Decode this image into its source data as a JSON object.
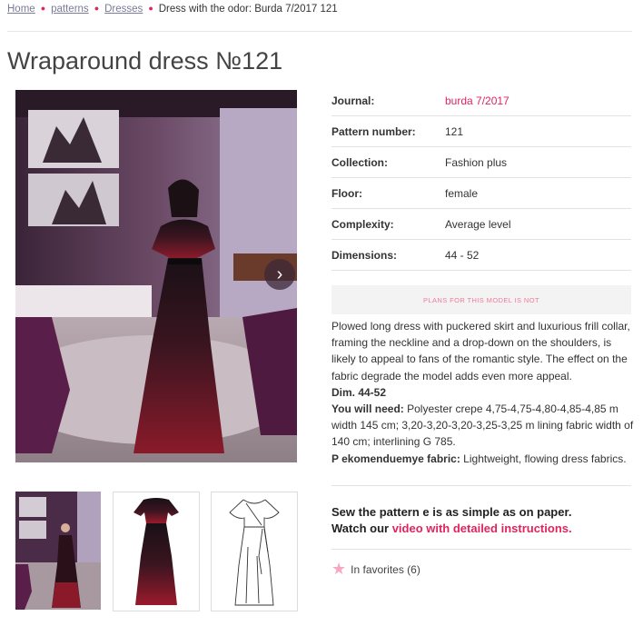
{
  "breadcrumb": {
    "items": [
      "Home",
      "patterns",
      "Dresses"
    ],
    "current": "Dress with the odor: Burda 7/2017 121"
  },
  "title": "Wraparound dress №121",
  "specs": [
    {
      "key": "Journal:",
      "value": "burda 7/2017"
    },
    {
      "key": "Pattern number:",
      "value": "121"
    },
    {
      "key": "Collection:",
      "value": "Fashion plus"
    },
    {
      "key": "Floor:",
      "value": "female"
    },
    {
      "key": "Complexity:",
      "value": "Average level"
    },
    {
      "key": "Dimensions:",
      "value": "44 - 52"
    }
  ],
  "plans_notice": "PLANS FOR THIS MODEL IS NOT",
  "description": {
    "text": "Plowed long dress with puckered skirt and luxurious frill collar, framing the neckline and a drop-down on the shoulders, is likely to appeal to fans of the romantic style. The effect on the fabric degrade the model adds even more appeal.",
    "dim": "Dim. 44-52",
    "need_label": "You will need:",
    "need_text": " Polyester crepe 4,75-4,75-4,80-4,85-4,85 m width 145 cm; 3,20-3,20-3,20-3,25-3,25 m lining fabric width of 140 cm; interlining G 785.",
    "fabric_label": "P ekomenduemye fabric:",
    "fabric_text": " Lightweight, flowing dress fabrics."
  },
  "sew": {
    "line1": "Sew the pattern e is as simple as on paper.",
    "line2_prefix": "Watch our ",
    "video_link": "video with detailed instructions."
  },
  "favorites": {
    "label": "In favorites (6)"
  },
  "icons": {
    "next": "chevron-right-icon",
    "star": "star-icon"
  },
  "colors": {
    "accent": "#e0245e",
    "link": "#7a7a9a"
  }
}
